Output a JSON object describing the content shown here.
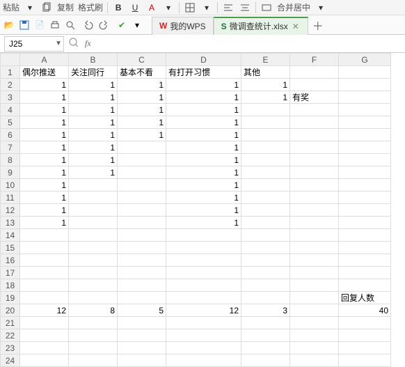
{
  "toolbar1": {
    "paste": "粘贴",
    "copy": "复制",
    "format_brush": "格式刷",
    "merge_center": "合并居中"
  },
  "tabs": {
    "wps": "我的WPS",
    "file": "微调查统计.xlsx"
  },
  "namebox": "J25",
  "columns": [
    "A",
    "B",
    "C",
    "D",
    "E",
    "F",
    "G"
  ],
  "headers": {
    "A": "偶尔推送",
    "B": "关注同行",
    "C": "基本不看",
    "D": "有打开习惯",
    "E": "其他"
  },
  "f3": "有奖",
  "g19": "回复人数",
  "sums": {
    "A": "12",
    "B": "8",
    "C": "5",
    "D": "12",
    "E": "3",
    "G": "40"
  },
  "rows": [
    {
      "n": 2,
      "A": "1",
      "B": "1",
      "C": "1",
      "D": "1",
      "E": "1"
    },
    {
      "n": 3,
      "A": "1",
      "B": "1",
      "C": "1",
      "D": "1",
      "E": "1"
    },
    {
      "n": 4,
      "A": "1",
      "B": "1",
      "C": "1",
      "D": "1"
    },
    {
      "n": 5,
      "A": "1",
      "B": "1",
      "C": "1",
      "D": "1"
    },
    {
      "n": 6,
      "A": "1",
      "B": "1",
      "C": "1",
      "D": "1"
    },
    {
      "n": 7,
      "A": "1",
      "B": "1",
      "D": "1"
    },
    {
      "n": 8,
      "A": "1",
      "B": "1",
      "D": "1"
    },
    {
      "n": 9,
      "A": "1",
      "B": "1",
      "D": "1"
    },
    {
      "n": 10,
      "A": "1",
      "D": "1"
    },
    {
      "n": 11,
      "A": "1",
      "D": "1"
    },
    {
      "n": 12,
      "A": "1",
      "D": "1"
    },
    {
      "n": 13,
      "A": "1",
      "D": "1"
    }
  ]
}
